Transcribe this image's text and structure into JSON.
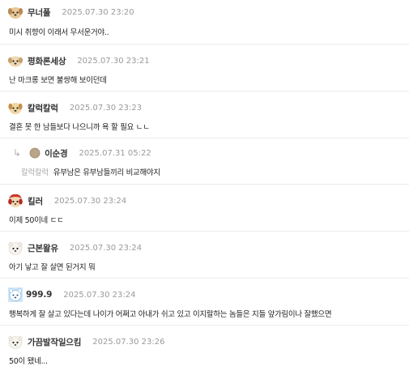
{
  "comments": [
    {
      "nickname": "무너풀",
      "date": "2025.07.30 23:20",
      "text": "미시 취향이 이래서 무서운거야..",
      "avatar": "puppy-icon"
    },
    {
      "nickname": "평화론세상",
      "date": "2025.07.30 23:21",
      "text": "난 마크롱 보면 불쌍해 보이던데",
      "avatar": "puppy-icon"
    },
    {
      "nickname": "칼럭칼럭",
      "date": "2025.07.30 23:23",
      "text": "결혼 못 한 남들보다 나으니까 욕 할 필요 ㄴㄴ",
      "avatar": "puppy-icon"
    },
    {
      "nickname": "이순경",
      "date": "2025.07.31 05:22",
      "mention": "칼럭칼럭",
      "text": "유부남은 유부남들끼리 비교해야지",
      "avatar": "round-avatar-icon",
      "is_reply": true
    },
    {
      "nickname": "킬러",
      "date": "2025.07.30 23:24",
      "text": "이제 50이네 ㄷㄷ",
      "avatar": "red-dog-icon"
    },
    {
      "nickname": "근본왈유",
      "date": "2025.07.30 23:24",
      "text": "아기 낳고 잘 살면 된거지 뭐",
      "avatar": "white-dog-icon"
    },
    {
      "nickname": "999.9",
      "date": "2025.07.30 23:24",
      "text": "행복하게 잘 살고 있다는데 나이가 어쩌고 아내가 쉬고 있고 이지랄하는 놈들은 지들 앞가림이나 잘했으면",
      "avatar": "blue-bear-icon"
    },
    {
      "nickname": "가끔발작일으킴",
      "date": "2025.07.30 23:26",
      "text": "50이 됐네...",
      "avatar": "white-dog-icon"
    }
  ]
}
